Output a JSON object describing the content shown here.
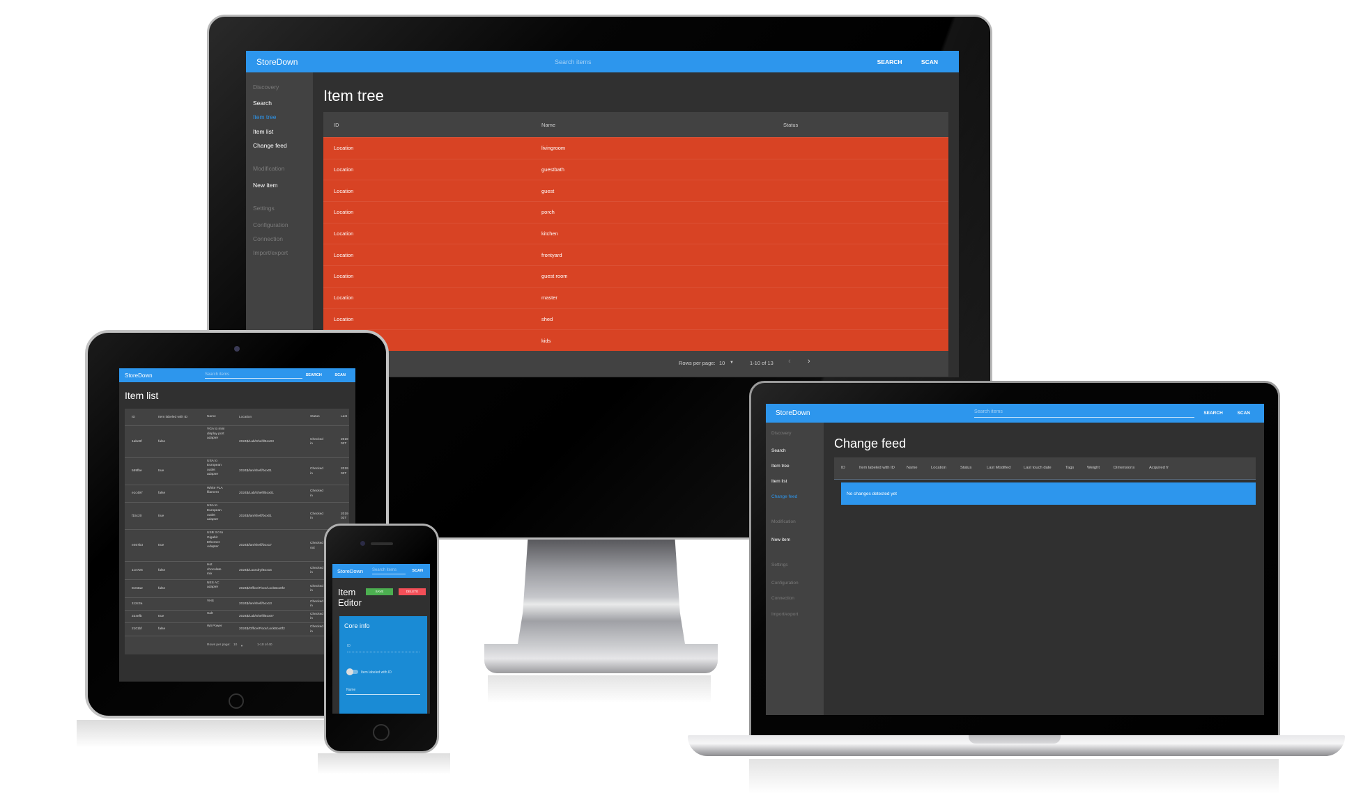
{
  "app": {
    "brand": "StoreDown",
    "search_placeholder": "Search items",
    "search_label": "SEARCH",
    "scan_label": "SCAN"
  },
  "colors": {
    "appbar": "#2d96ed",
    "row_highlight": "#d84324",
    "save": "#4caf50",
    "delete": "#f44f58",
    "card": "#1a8bd5"
  },
  "sidebar": {
    "sections": [
      {
        "label": "Discovery",
        "items": [
          "Search",
          "Item tree",
          "Item list",
          "Change feed"
        ]
      },
      {
        "label": "Modification",
        "items": [
          "New item"
        ]
      },
      {
        "label": "Settings",
        "items": [
          "Configuration",
          "Connection",
          "Import/export"
        ]
      }
    ]
  },
  "monitor": {
    "page_title": "Item tree",
    "active_item": "Item tree",
    "columns": [
      "ID",
      "Name",
      "Status"
    ],
    "rows": [
      {
        "id": "Location",
        "name": "livingroom",
        "status": ""
      },
      {
        "id": "Location",
        "name": "guestbath",
        "status": ""
      },
      {
        "id": "Location",
        "name": "guest",
        "status": ""
      },
      {
        "id": "Location",
        "name": "porch",
        "status": ""
      },
      {
        "id": "Location",
        "name": "kitchen",
        "status": ""
      },
      {
        "id": "Location",
        "name": "frontyard",
        "status": ""
      },
      {
        "id": "Location",
        "name": "guest room",
        "status": ""
      },
      {
        "id": "Location",
        "name": "master",
        "status": ""
      },
      {
        "id": "Location",
        "name": "shed",
        "status": ""
      },
      {
        "id": "",
        "name": "kids",
        "status": ""
      }
    ],
    "pager": {
      "rows_per_page_label": "Rows per page:",
      "rows_per_page": "10",
      "range": "1-10 of 13",
      "prev": "‹",
      "next": "›",
      "dropdown": "▼"
    }
  },
  "tablet": {
    "page_title": "Item list",
    "columns": [
      "ID",
      "Item labeled with ID",
      "Name",
      "Location",
      "Status",
      "Last"
    ],
    "rows": [
      {
        "id": "1abe9f",
        "labeled": "false",
        "name": "VGA to mini display port adapter",
        "location": "2024$/Lab/Shelf/Box03",
        "status": "Checked in",
        "last": "2019 02T"
      },
      {
        "id": "559fbe",
        "labeled": "true",
        "name": "USA to European outlet adapter",
        "location": "2024$/lan/shelf/box01",
        "status": "Checked in",
        "last": "2019 03T"
      },
      {
        "id": "e1c497",
        "labeled": "false",
        "name": "White PLA filament",
        "location": "2024$/Lab/Shelf/Box01",
        "status": "Checked in",
        "last": ""
      },
      {
        "id": "f15c20",
        "labeled": "true",
        "name": "USA to European outlet adapter",
        "location": "2024$/lan/shelf/box01",
        "status": "Checked in",
        "last": "2019 03T"
      },
      {
        "id": "e467b3",
        "labeled": "true",
        "name": "USB 3.0 to Gigabit Ethernet Adapter",
        "location": "2024$/lan/shelf/box17",
        "status": "Checked out",
        "last": ""
      },
      {
        "id": "1ce726",
        "labeled": "false",
        "name": "Hot chocolate mix",
        "location": "2024$/Laundry/Box15",
        "status": "Checked in",
        "last": ""
      },
      {
        "id": "8c03a2",
        "labeled": "false",
        "name": "NES AC adapter",
        "location": "2024$/Office/Floor/LockBox0f2",
        "status": "Checked in",
        "last": ""
      },
      {
        "id": "112c3a",
        "labeled": "",
        "name": "VHS",
        "location": "2024$/lan/shelf/box13",
        "status": "Checked in",
        "last": ""
      },
      {
        "id": "224efb",
        "labeled": "true",
        "name": "Salt",
        "location": "2024$/Lab/Shelf/Box07",
        "status": "Checked in",
        "last": ""
      },
      {
        "id": "2101bf",
        "labeled": "false",
        "name": "Wii Power",
        "location": "2024$/Office/Floor/LockBox0f2",
        "status": "Checked in",
        "last": ""
      }
    ],
    "pager": {
      "rows_per_page_label": "Rows per page:",
      "rows_per_page": "10",
      "range": "1-10 of 40",
      "dropdown": "▼"
    }
  },
  "phone": {
    "title_line1": "Item",
    "title_line2": "Editor",
    "save_label": "SAVE",
    "delete_label": "DELETE",
    "card_title": "Core info",
    "id_placeholder": "ID",
    "toggle_label": "Item labeled with ID",
    "toggle_on": false,
    "name_placeholder": "Name"
  },
  "laptop": {
    "page_title": "Change feed",
    "active_item": "Change feed",
    "columns": [
      "ID",
      "Item labeled with ID",
      "Name",
      "Location",
      "Status",
      "Last Modified",
      "Last touch date",
      "Tags",
      "Weight",
      "Dimensions",
      "Acquired fr"
    ],
    "empty_message": "No changes detected yet"
  }
}
